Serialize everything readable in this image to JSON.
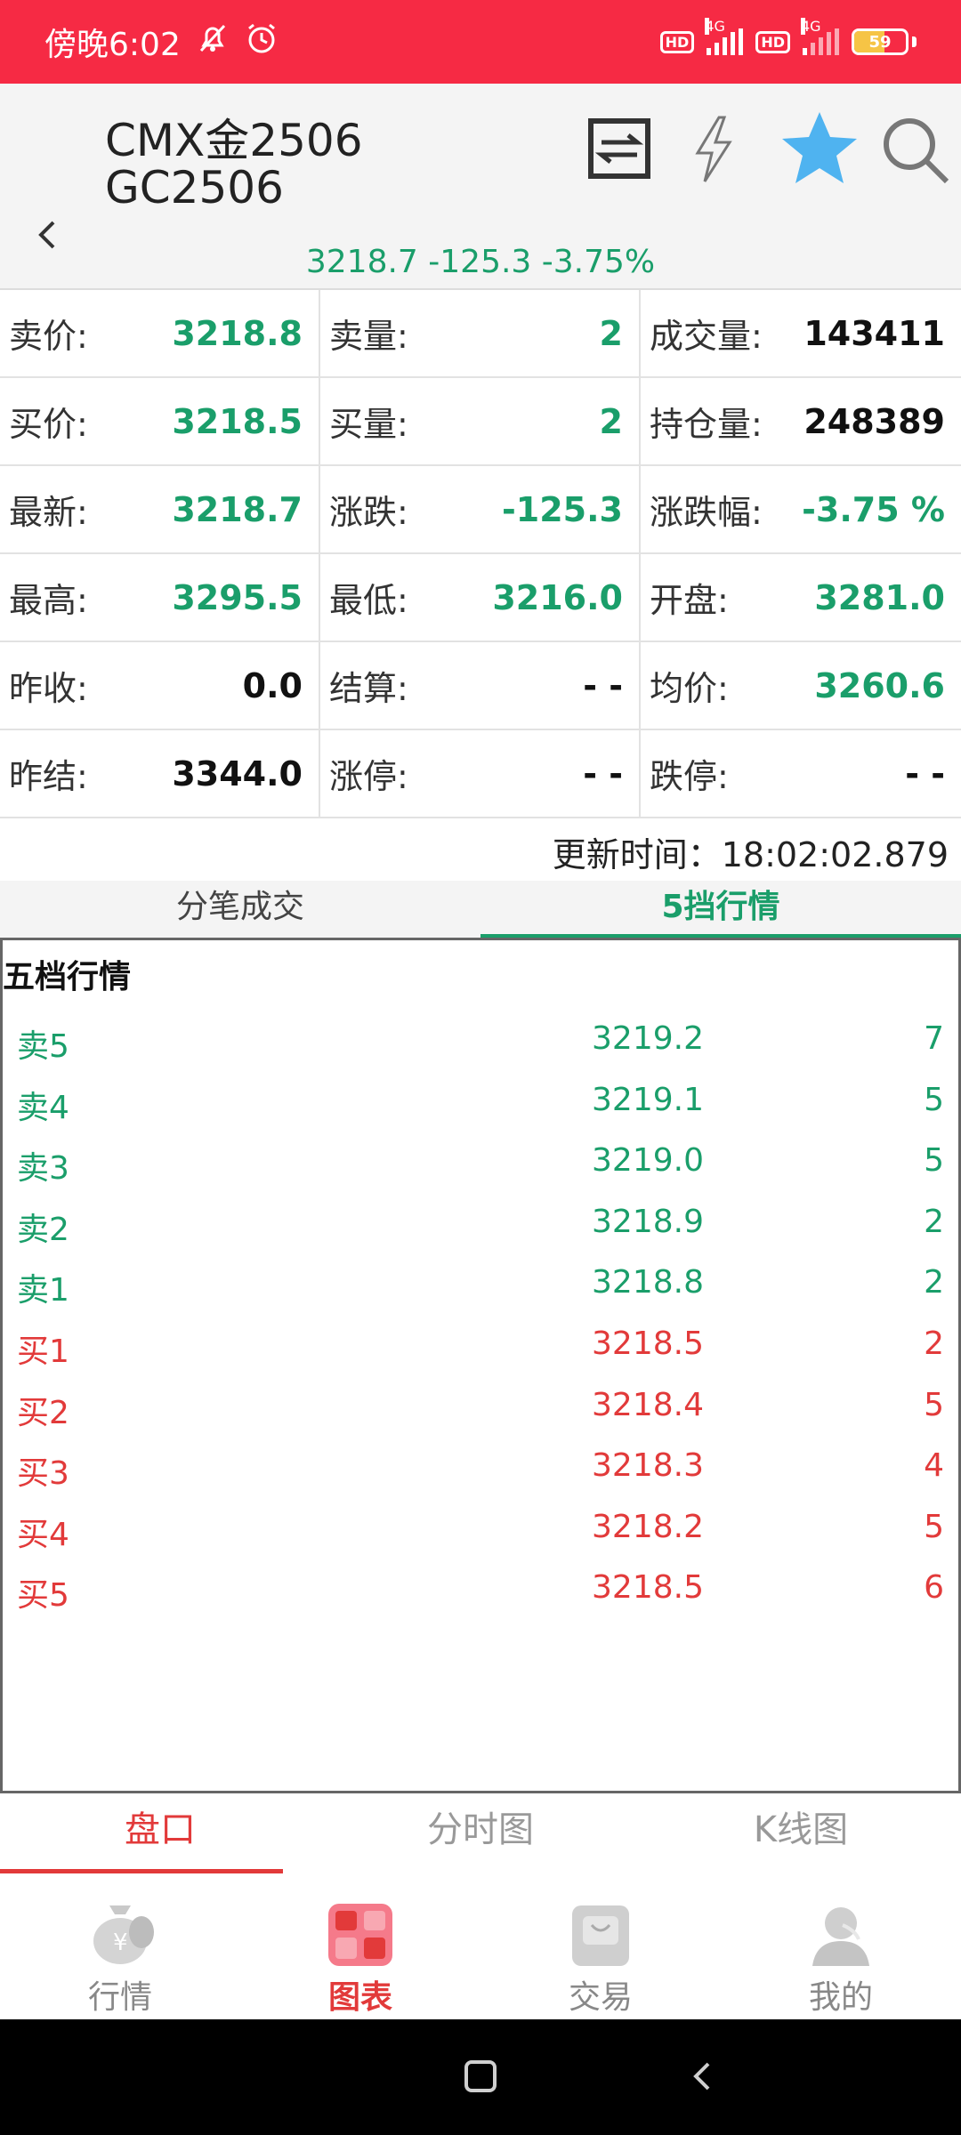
{
  "status_bar": {
    "time": "傍晚6:02",
    "battery_level": "59",
    "battery_fraction": 0.59,
    "network_1": "4G",
    "network_2": "4G",
    "hd_label": "HD"
  },
  "header": {
    "title_line1": "CMX金2506",
    "title_line2": "GC2506",
    "summary": "3218.7 -125.3 -3.75%"
  },
  "quote_grid": [
    [
      {
        "label": "卖价:",
        "value": "3218.8",
        "color": "green"
      },
      {
        "label": "卖量:",
        "value": "2",
        "color": "green"
      },
      {
        "label": "成交量:",
        "value": "143411",
        "color": "black"
      }
    ],
    [
      {
        "label": "买价:",
        "value": "3218.5",
        "color": "green"
      },
      {
        "label": "买量:",
        "value": "2",
        "color": "green"
      },
      {
        "label": "持仓量:",
        "value": "248389",
        "color": "black"
      }
    ],
    [
      {
        "label": "最新:",
        "value": "3218.7",
        "color": "green"
      },
      {
        "label": "涨跌:",
        "value": "-125.3",
        "color": "green"
      },
      {
        "label": "涨跌幅:",
        "value": "-3.75 %",
        "color": "green"
      }
    ],
    [
      {
        "label": "最高:",
        "value": "3295.5",
        "color": "green"
      },
      {
        "label": "最低:",
        "value": "3216.0",
        "color": "green"
      },
      {
        "label": "开盘:",
        "value": "3281.0",
        "color": "green"
      }
    ],
    [
      {
        "label": "昨收:",
        "value": "0.0",
        "color": "black"
      },
      {
        "label": "结算:",
        "value": "- -",
        "color": "black"
      },
      {
        "label": "均价:",
        "value": "3260.6",
        "color": "green"
      }
    ],
    [
      {
        "label": "昨结:",
        "value": "3344.0",
        "color": "black"
      },
      {
        "label": "涨停:",
        "value": "- -",
        "color": "black"
      },
      {
        "label": "跌停:",
        "value": "- -",
        "color": "black"
      }
    ]
  ],
  "update_time": "更新时间：18:02:02.879",
  "tabs": [
    {
      "label": "分笔成交",
      "active": false
    },
    {
      "label": "5挡行情",
      "active": true
    }
  ],
  "depth": {
    "title": "五档行情",
    "rows": [
      {
        "name": "卖5",
        "price": "3219.2",
        "volume": "7",
        "side": "sell"
      },
      {
        "name": "卖4",
        "price": "3219.1",
        "volume": "5",
        "side": "sell"
      },
      {
        "name": "卖3",
        "price": "3219.0",
        "volume": "5",
        "side": "sell"
      },
      {
        "name": "卖2",
        "price": "3218.9",
        "volume": "2",
        "side": "sell"
      },
      {
        "name": "卖1",
        "price": "3218.8",
        "volume": "2",
        "side": "sell"
      },
      {
        "name": "买1",
        "price": "3218.5",
        "volume": "2",
        "side": "buy"
      },
      {
        "name": "买2",
        "price": "3218.4",
        "volume": "5",
        "side": "buy"
      },
      {
        "name": "买3",
        "price": "3218.3",
        "volume": "4",
        "side": "buy"
      },
      {
        "name": "买4",
        "price": "3218.2",
        "volume": "5",
        "side": "buy"
      },
      {
        "name": "买5",
        "price": "3218.5",
        "volume": "6",
        "side": "buy"
      }
    ]
  },
  "sub_nav": [
    {
      "label": "盘口",
      "active": true
    },
    {
      "label": "分时图",
      "active": false
    },
    {
      "label": "K线图",
      "active": false
    }
  ],
  "bottom_nav": [
    {
      "label": "行情",
      "icon": "money-bag-icon",
      "active": false
    },
    {
      "label": "图表",
      "icon": "chart-grid-icon",
      "active": true
    },
    {
      "label": "交易",
      "icon": "shopping-bag-icon",
      "active": false
    },
    {
      "label": "我的",
      "icon": "user-icon",
      "active": false
    }
  ],
  "colors": {
    "accent_red": "#f62a44",
    "up_red": "#e23a3a",
    "down_green": "#1a9e6a",
    "star_blue": "#4fb3f0"
  }
}
